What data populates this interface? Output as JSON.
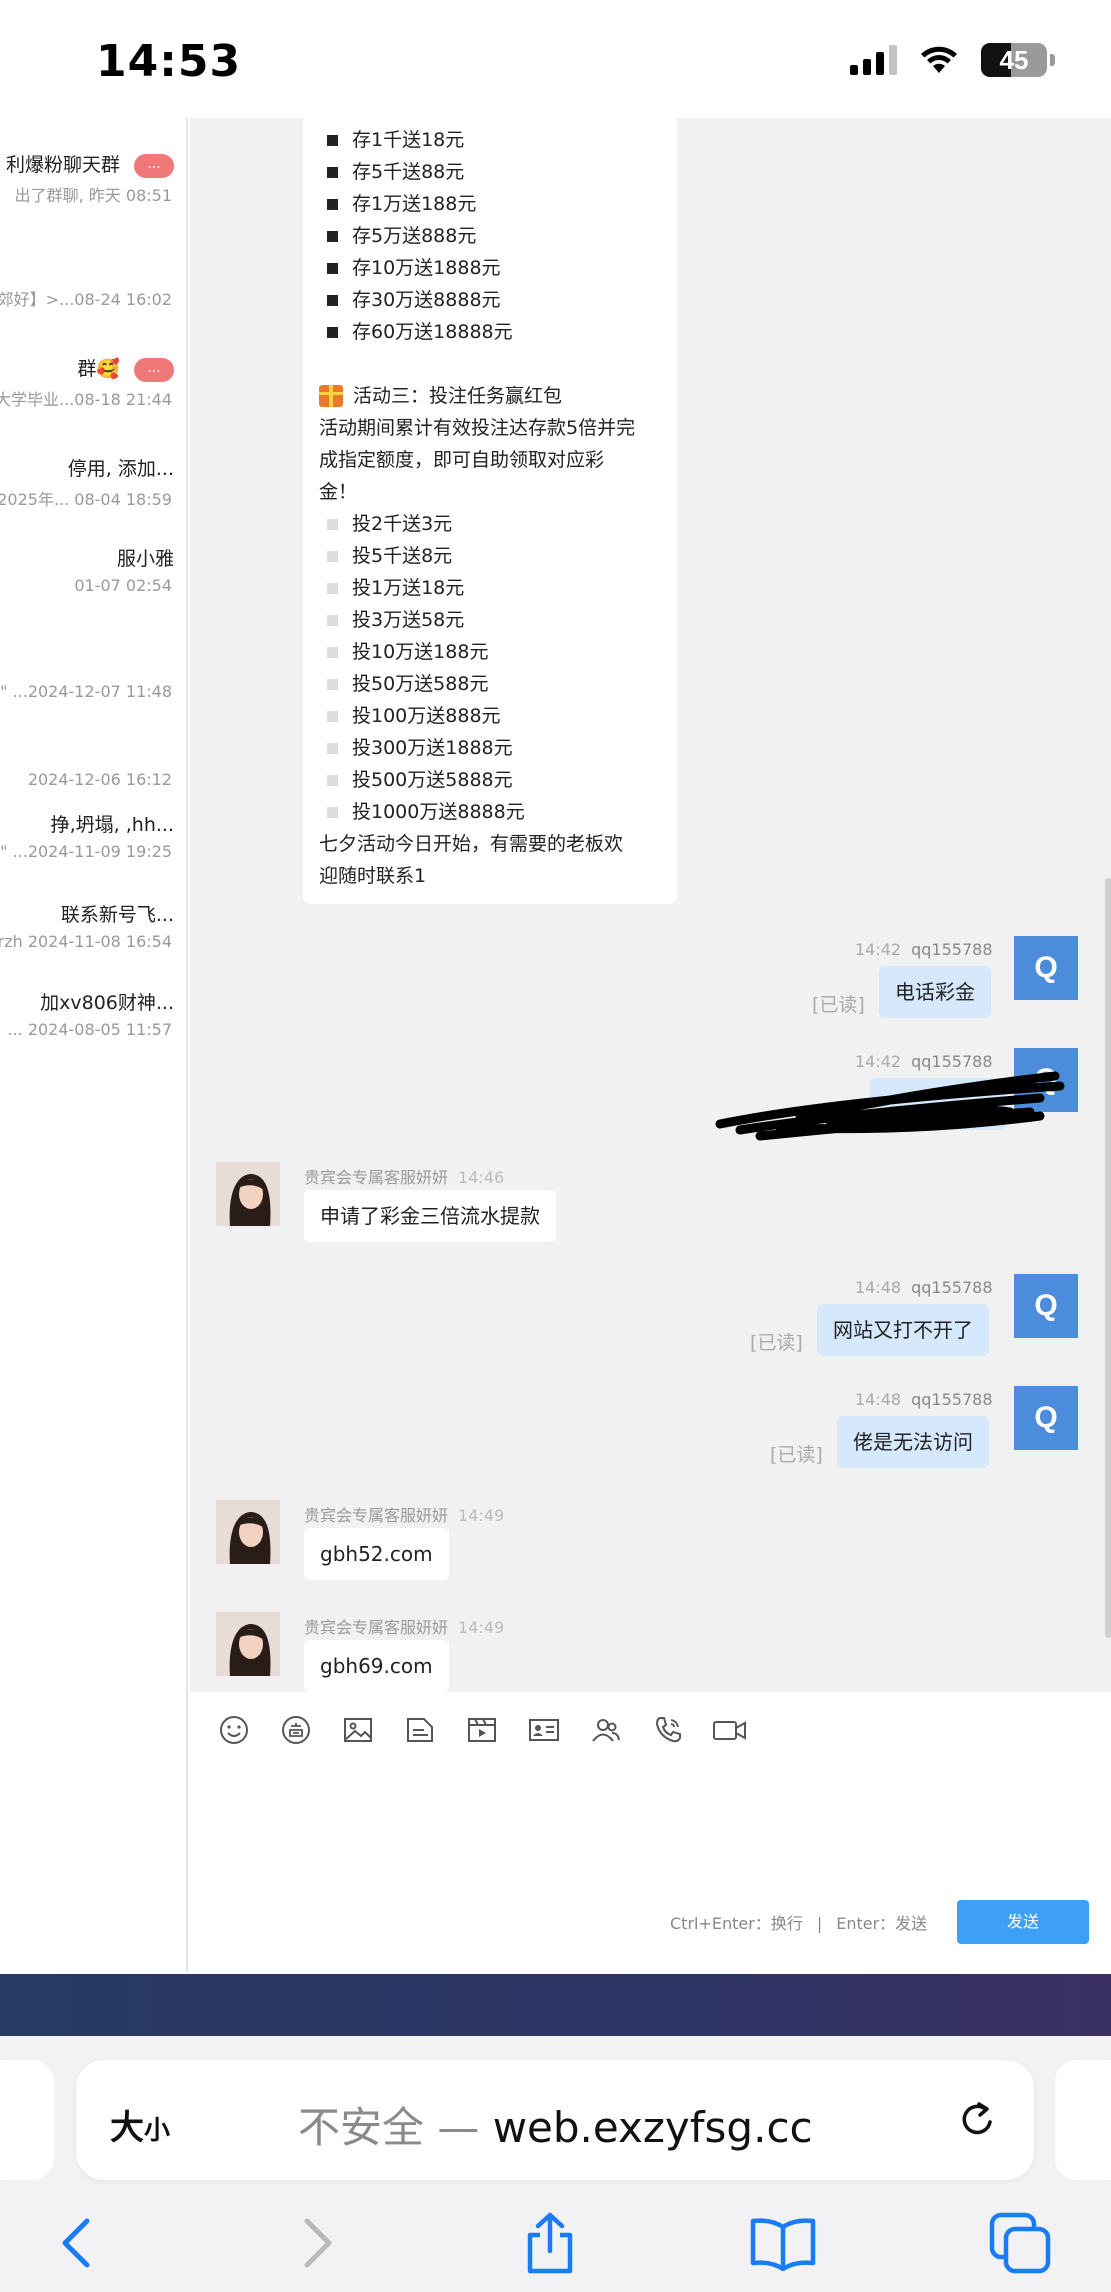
{
  "status_bar": {
    "time": "14:53",
    "battery": "45",
    "battery_level": 0.45
  },
  "conversations": [
    {
      "name": "利爆粉聊天群",
      "sub": "出了群聊, 昨天 08:51",
      "badge": "..."
    },
    {
      "name": "",
      "sub": "郊好】>...08-24 16:02",
      "badge": ""
    },
    {
      "name": "群🥰",
      "sub": "大学毕业...08-18 21:44",
      "badge": "..."
    },
    {
      "name": "停用, 添加...",
      "sub": "2025年... 08-04 18:59",
      "badge": ""
    },
    {
      "name": "服小雅",
      "sub": "01-07 02:54",
      "badge": ""
    },
    {
      "name": "",
      "sub": "\" ...2024-12-07 11:48",
      "badge": ""
    },
    {
      "name": "",
      "sub": "2024-12-06 16:12",
      "badge": ""
    },
    {
      "name": "挣,坍塌, ,hh...",
      "sub": "\" ...2024-11-09 19:25",
      "badge": ""
    },
    {
      "name": "联系新号飞...",
      "sub": "irzh 2024-11-08 16:54",
      "badge": ""
    },
    {
      "name": "加xv806财神...",
      "sub": "... 2024-08-05 11:57",
      "badge": ""
    }
  ],
  "promo": {
    "deposit_items": [
      "存1千送18元",
      "存5千送88元",
      "存1万送188元",
      "存5万送888元",
      "存10万送1888元",
      "存30万送8888元",
      "存60万送18888元"
    ],
    "activity3_title": "活动三：投注任务赢红包",
    "activity3_desc_1": "活动期间累计有效投注达存款5倍并完",
    "activity3_desc_2": "成指定额度，即可自助领取对应彩",
    "activity3_desc_3": "金！",
    "bet_items": [
      "投2千送3元",
      "投5千送8元",
      "投1万送18元",
      "投3万送58元",
      "投10万送188元",
      "投50万送588元",
      "投100万送888元",
      "投300万送1888元",
      "投500万送5888元",
      "投1000万送8888元"
    ],
    "closing_1": "七夕活动今日开始，有需要的老板欢",
    "closing_2": "迎随时联系1"
  },
  "messages": {
    "user_name": "qq155788",
    "agent_name": "贵宾会专属客服妍妍",
    "read_label": "[已读]",
    "avatar_letter": "Q",
    "m1": {
      "time": "14:42",
      "text": "电话彩金"
    },
    "m2": {
      "time": "14:42"
    },
    "m3": {
      "time": "14:46",
      "text": "申请了彩金三倍流水提款"
    },
    "m4": {
      "time": "14:48",
      "text": "网站又打不开了"
    },
    "m5": {
      "time": "14:48",
      "text": "佬是无法访问"
    },
    "m6": {
      "time": "14:49",
      "text": "gbh52.com"
    },
    "m7": {
      "time": "14:49",
      "text": "gbh69.com"
    }
  },
  "input": {
    "hint_newline": "Ctrl+Enter：换行",
    "hint_sep": "|",
    "hint_send": "Enter：发送",
    "send_label": "发送"
  },
  "safari": {
    "aa_big": "大",
    "aa_small": "小",
    "insecure_label": "不安全 — ",
    "domain": "web.exzyfsg.cc"
  },
  "colors": {
    "accent": "#3d9ff5",
    "bubble_self": "#d5e8fc",
    "avatar": "#4b8ddb",
    "badge": "#f07878"
  }
}
